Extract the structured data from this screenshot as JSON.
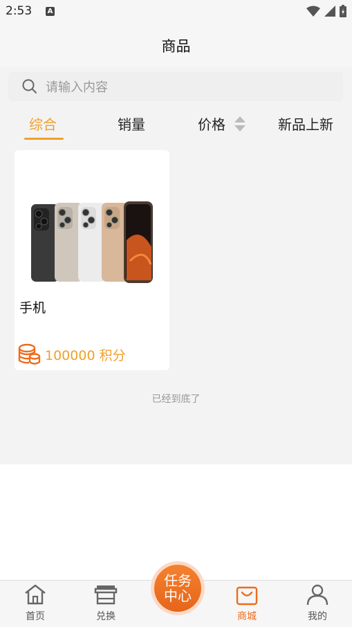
{
  "status_bar": {
    "time": "2:53",
    "notification_badge": "A"
  },
  "header": {
    "title": "商品"
  },
  "search": {
    "placeholder": "请输入内容"
  },
  "tabs": [
    {
      "label": "综合",
      "active": true
    },
    {
      "label": "销量",
      "active": false
    },
    {
      "label": "价格",
      "active": false
    },
    {
      "label": "新品上新",
      "active": false
    }
  ],
  "products": [
    {
      "name": "手机",
      "points": "100000 积分"
    }
  ],
  "list_end_text": "已经到底了",
  "bottom_nav": {
    "items": [
      {
        "label": "首页",
        "icon": "home-icon",
        "active": false
      },
      {
        "label": "兑换",
        "icon": "store-icon",
        "active": false
      },
      {
        "label": "商城",
        "icon": "shopping-bag-icon",
        "active": true
      },
      {
        "label": "我的",
        "icon": "user-icon",
        "active": false
      }
    ],
    "center": {
      "line1": "任务",
      "line2": "中心"
    }
  },
  "colors": {
    "accent": "#f0a02b",
    "active_nav": "#ee6b1b",
    "background": "#f3f3f3"
  }
}
